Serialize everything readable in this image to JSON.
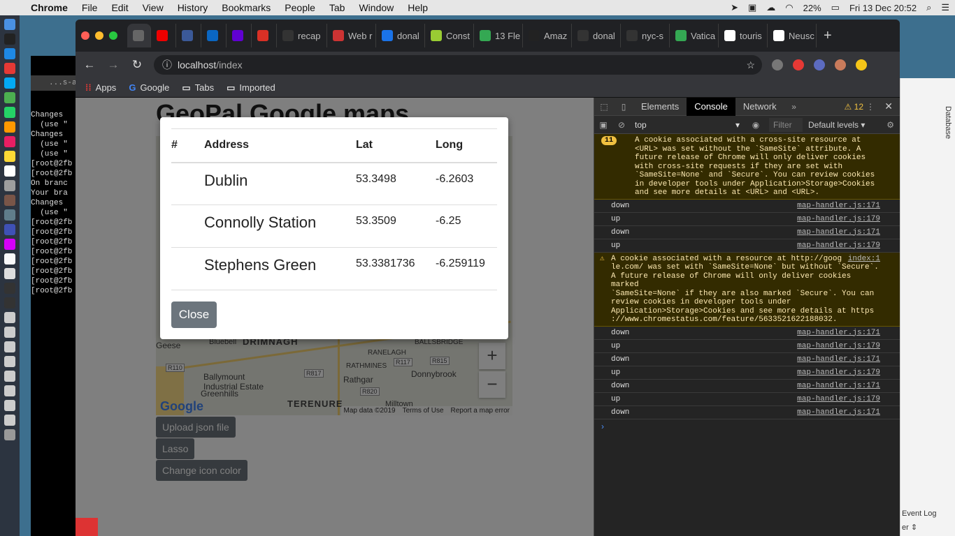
{
  "menubar": {
    "app": "Chrome",
    "items": [
      "File",
      "Edit",
      "View",
      "History",
      "Bookmarks",
      "People",
      "Tab",
      "Window",
      "Help"
    ],
    "battery": "22%",
    "datetime": "Fri 13 Dec  20:52"
  },
  "terminal": {
    "title": "...s-ap",
    "lines": [
      "Changes",
      "  (use \"",
      "",
      "",
      "",
      "",
      "",
      "",
      "",
      "",
      "",
      "",
      "",
      "Changes",
      "  (use \"",
      "  (use \"",
      "",
      "",
      "[root@2fb",
      "[root@2fb",
      "On branc",
      "Your bra",
      "Changes",
      "  (use \"",
      "",
      "",
      "",
      "",
      "",
      "",
      "",
      "",
      "",
      "",
      "",
      "",
      "",
      "[root@2fb",
      "[root@2fb",
      "[root@2fb",
      "[root@2fb",
      "[root@2fb",
      "[root@2fb",
      "[root@2fb",
      "[root@2fb"
    ]
  },
  "side_app": {
    "vertical_label": "Database",
    "event_log": "Event Log"
  },
  "browser": {
    "tabs": [
      {
        "label": "",
        "color": "#666"
      },
      {
        "label": "",
        "color": "#e00"
      },
      {
        "label": "",
        "color": "#3b5998"
      },
      {
        "label": "",
        "color": "#0a66c2"
      },
      {
        "label": "",
        "color": "#6001d2"
      },
      {
        "label": "",
        "color": "#d93025"
      },
      {
        "label": "recap",
        "color": "#333"
      },
      {
        "label": "Web r",
        "color": "#c33"
      },
      {
        "label": "donal",
        "color": "#1a73e8"
      },
      {
        "label": "Const",
        "color": "#9c3"
      },
      {
        "label": "13 Fle",
        "color": "#34a853"
      },
      {
        "label": "Amaz",
        "color": "#222"
      },
      {
        "label": "donal",
        "color": "#333"
      },
      {
        "label": "nyc-s",
        "color": "#333"
      },
      {
        "label": "Vatica",
        "color": "#34a853"
      },
      {
        "label": "touris",
        "color": "#fff"
      },
      {
        "label": "Neusc",
        "color": "#fff"
      }
    ],
    "url_host": "localhost",
    "url_path": "/index",
    "bookmarks": [
      "Apps",
      "Google",
      "Tabs",
      "Imported"
    ]
  },
  "page": {
    "title": "GeoPal Google maps",
    "buttons": [
      "Upload json file",
      "Lasso",
      "Change icon color"
    ],
    "map": {
      "labels": [
        "Bluebell",
        "DRIMNAGH",
        "Ballymount Industrial Estate",
        "Greenhills",
        "RATHMINES",
        "Rathgar",
        "Donnybrook",
        "TERENURE",
        "Milltown",
        "RANELAGH",
        "BALLSBRIDGE",
        "Geese",
        "R110",
        "R117",
        "R815",
        "R817",
        "R820"
      ],
      "footer": [
        "Map data ©2019",
        "Terms of Use",
        "Report a map error"
      ],
      "google": "Google"
    }
  },
  "modal": {
    "headers": [
      "#",
      "Address",
      "Lat",
      "Long"
    ],
    "rows": [
      {
        "num": "",
        "address": "Dublin",
        "lat": "53.3498",
        "long": "-6.2603"
      },
      {
        "num": "",
        "address": "Connolly Station",
        "lat": "53.3509",
        "long": "-6.25"
      },
      {
        "num": "",
        "address": "Stephens Green",
        "lat": "53.3381736",
        "long": "-6.259119"
      }
    ],
    "close": "Close"
  },
  "devtools": {
    "tabs": [
      "Elements",
      "Console",
      "Network"
    ],
    "warning_count": "12",
    "context": "top",
    "filter_placeholder": "Filter",
    "levels": "Default levels",
    "logs": [
      {
        "type": "warn",
        "badge": "11",
        "msg": "A cookie associated with a cross-site resource at\n<URL> was set without the `SameSite` attribute. A\nfuture release of Chrome will only deliver cookies\nwith cross-site requests if they are set with\n`SameSite=None` and `Secure`. You can review cookies\nin developer tools under Application>Storage>Cookies\nand see more details at <URL> and <URL>.",
        "src": ""
      },
      {
        "type": "log",
        "msg": "down",
        "src": "map-handler.js:171"
      },
      {
        "type": "log",
        "msg": "up",
        "src": "map-handler.js:179"
      },
      {
        "type": "log",
        "msg": "down",
        "src": "map-handler.js:171"
      },
      {
        "type": "log",
        "msg": "up",
        "src": "map-handler.js:179"
      },
      {
        "type": "warn2",
        "msg": "A cookie associated with a resource at http://goog\nle.com/ was set with `SameSite=None` but without `Secure`.\nA future release of Chrome will only deliver cookies marked\n`SameSite=None` if they are also marked `Secure`. You can\nreview cookies in developer tools under\nApplication>Storage>Cookies and see more details at https\n://www.chromestatus.com/feature/5633521622188032.",
        "src": "index:1"
      },
      {
        "type": "log",
        "msg": "down",
        "src": "map-handler.js:171"
      },
      {
        "type": "log",
        "msg": "up",
        "src": "map-handler.js:179"
      },
      {
        "type": "log",
        "msg": "down",
        "src": "map-handler.js:171"
      },
      {
        "type": "log",
        "msg": "up",
        "src": "map-handler.js:179"
      },
      {
        "type": "log",
        "msg": "down",
        "src": "map-handler.js:171"
      },
      {
        "type": "log",
        "msg": "up",
        "src": "map-handler.js:179"
      },
      {
        "type": "log",
        "msg": "down",
        "src": "map-handler.js:171"
      }
    ]
  }
}
